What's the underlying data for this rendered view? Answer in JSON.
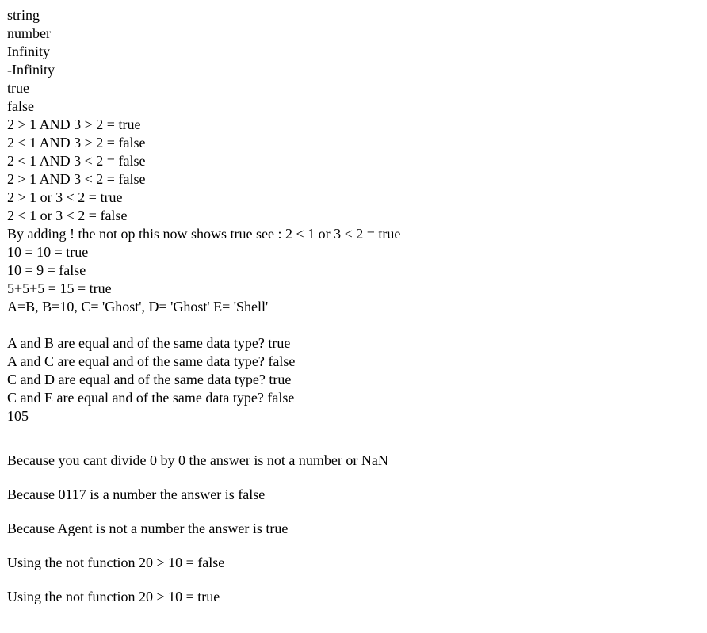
{
  "lines": [
    "string",
    "number",
    "Infinity",
    "-Infinity",
    "true",
    "false",
    "2 > 1 AND 3 > 2 = true",
    "2 < 1 AND 3 > 2 = false",
    "2 < 1 AND 3 < 2 = false",
    "2 > 1 AND 3 < 2 = false",
    "2 > 1 or 3 < 2 = true",
    "2 < 1 or 3 < 2 = false",
    "By adding ! the not op this now shows true see : 2 < 1 or 3 < 2 = true",
    "10 = 10 = true",
    "10 = 9 = false",
    "5+5+5 = 15 = true",
    "A=B, B=10, C= 'Ghost', D= 'Ghost' E= 'Shell'"
  ],
  "comparisons": [
    "A and B are equal and of the same data type? true",
    "A and C are equal and of the same data type? false",
    "C and D are equal and of the same data type? true",
    "C and E are equal and of the same data type? false",
    "105"
  ],
  "paragraphs": [
    "Because you cant divide 0 by 0 the answer is not a number or NaN",
    "Because 0117 is a number the answer is false",
    "Because Agent is not a number the answer is true",
    "Using the not function 20 > 10 = false",
    "Using the not function 20 > 10 = true"
  ]
}
